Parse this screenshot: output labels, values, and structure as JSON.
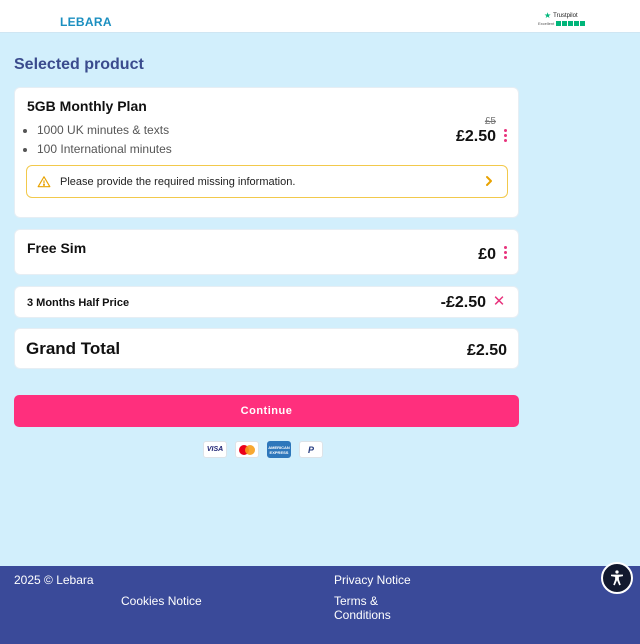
{
  "header": {
    "brand": "LEBARA",
    "trustpilot": {
      "name": "Trustpilot",
      "rating_label": "Excellent",
      "stars": 5,
      "star_color": "#00b67a"
    }
  },
  "section_title": "Selected product",
  "plan": {
    "name": "5GB Monthly Plan",
    "features": [
      "1000 UK minutes & texts",
      "100 International minutes"
    ],
    "old_price": "£5",
    "price": "£2.50",
    "warning": "Please provide the required missing information."
  },
  "sim": {
    "name": "Free Sim",
    "price": "£0"
  },
  "promo": {
    "name": "3 Months Half Price",
    "price": "-£2.50"
  },
  "total": {
    "label": "Grand Total",
    "price": "£2.50"
  },
  "continue_label": "Continue",
  "payment_methods": [
    "VISA",
    "mastercard-icon",
    "AMERICAN EXPRESS",
    "P"
  ],
  "footer": {
    "copyright": "2025 © Lebara",
    "privacy": "Privacy Notice",
    "cookies": "Cookies Notice",
    "terms": "Terms & Conditions"
  },
  "colors": {
    "accent": "#ff2f7d",
    "brand_blue": "#3a4b8d",
    "page_bg": "#d2effc",
    "footer_bg": "#3a4a99",
    "warning_border": "#f2c94c"
  }
}
